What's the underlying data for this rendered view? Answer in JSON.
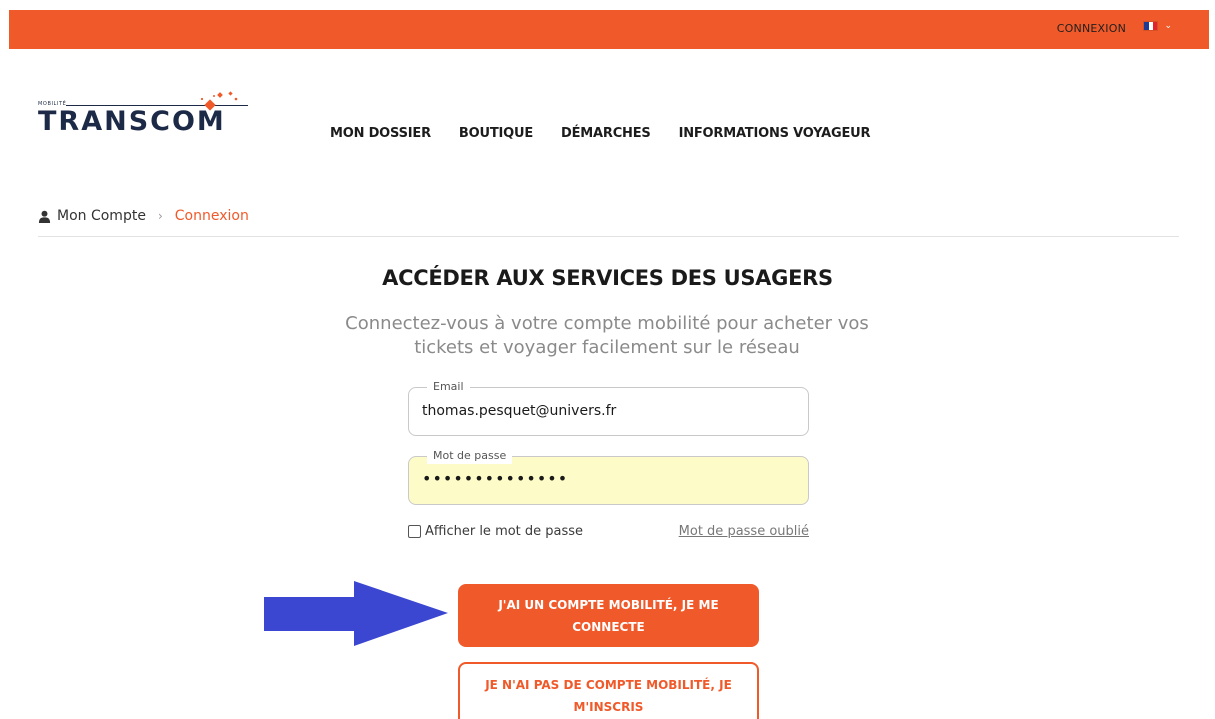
{
  "topbar": {
    "login_label": "CONNEXION",
    "language_flag_icon": "france-flag-icon",
    "dropdown_icon": "chevron-down-icon",
    "flag_colors": [
      "#1f3a93",
      "#ffffff",
      "#e3222b"
    ],
    "color": "#f05a2a"
  },
  "logo": {
    "subtitle": "MOBILITÉ",
    "text": "TRANSCOM",
    "text_color": "#1c2a47",
    "accent_color": "#f05a2a"
  },
  "nav": {
    "items": [
      {
        "label": "MON DOSSIER"
      },
      {
        "label": "BOUTIQUE"
      },
      {
        "label": "DÉMARCHES"
      },
      {
        "label": "INFORMATIONS VOYAGEUR"
      }
    ]
  },
  "breadcrumb": {
    "icon": "user-icon",
    "home": "Mon Compte",
    "separator": "›",
    "current": "Connexion"
  },
  "main": {
    "title": "ACCÉDER AUX SERVICES DES USAGERS",
    "subtitle_line1": "Connectez-vous à votre compte mobilité pour acheter vos",
    "subtitle_line2": "tickets et voyager facilement sur le réseau"
  },
  "form": {
    "email": {
      "label": "Email",
      "value": "thomas.pesquet@univers.fr"
    },
    "password": {
      "label": "Mot de passe",
      "value": "••••••••••••••"
    },
    "show_password_label": "Afficher le mot de passe",
    "forgot_password_label": "Mot de passe oublié"
  },
  "buttons": {
    "login": "J'AI UN COMPTE MOBILITÉ, JE ME CONNECTE",
    "register": "JE N'AI PAS DE COMPTE MOBILITÉ, JE M'INSCRIS"
  },
  "annotation": {
    "arrow_icon": "right-arrow-icon",
    "arrow_color": "#3b47d1"
  }
}
